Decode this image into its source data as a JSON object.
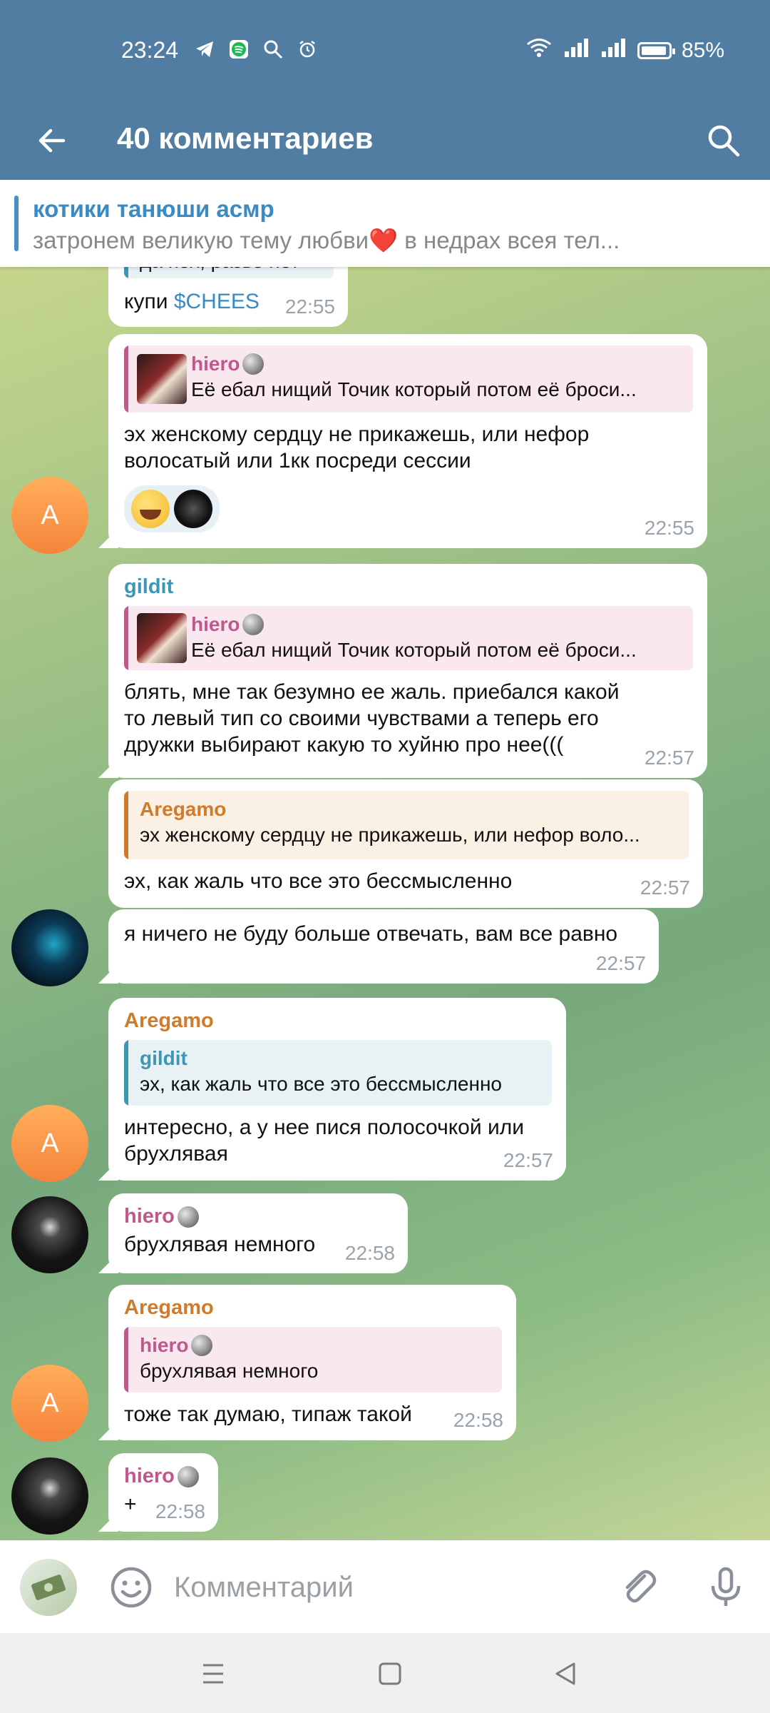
{
  "status_bar": {
    "time": "23:24",
    "battery": "85%",
    "battery_level": 0.85
  },
  "header": {
    "title": "40 комментариев"
  },
  "pinned": {
    "title": "котики танюши асмр",
    "text": "затронем великую тему любви❤️  в недрах всея тел..."
  },
  "messages": [
    {
      "partial_quote": "да пох, разве нет",
      "text_prefix": "купи ",
      "text_link": "$CHEES",
      "time": "22:55"
    },
    {
      "reply_name": "hiero",
      "reply_text": "Её ебал нищий Точик который потом её броси...",
      "text": "эх женскому сердцу не прикажешь, или нефор волосатый или 1кк посреди сессии",
      "avatar_letter": "A",
      "time": "22:55"
    },
    {
      "sender": "gildit",
      "reply_name": "hiero",
      "reply_text": "Её ебал нищий Точик который потом её броси...",
      "text": "блять, мне так безумно ее жаль. приебался какой то левый тип со своими чувствами а теперь его дружки выбирают какую то хуйню про нее(((",
      "time": "22:57"
    },
    {
      "reply_name": "Aregamo",
      "reply_text": "эх женскому сердцу не прикажешь, или нефор воло...",
      "text": "эх, как жаль что все это бессмысленно",
      "time": "22:57"
    },
    {
      "text": "я ничего не буду больше отвечать, вам все равно",
      "time": "22:57"
    },
    {
      "sender": "Aregamo",
      "reply_name": "gildit",
      "reply_text": "эх, как жаль что все это бессмысленно",
      "text": "интересно, а у нее пися полосочкой или брухлявая",
      "avatar_letter": "A",
      "time": "22:57"
    },
    {
      "sender": "hiero",
      "text": "брухлявая немного",
      "time": "22:58"
    },
    {
      "sender": "Aregamo",
      "reply_name": "hiero",
      "reply_text": "брухлявая немного",
      "text": "тоже так думаю, типаж такой",
      "avatar_letter": "A",
      "time": "22:58"
    },
    {
      "sender": "hiero",
      "text": "+",
      "time": "22:58"
    }
  ],
  "input": {
    "placeholder": "Комментарий"
  },
  "colors": {
    "header": "#527da3",
    "pink": "#c1588c",
    "teal": "#3d97b3",
    "orange": "#d07b2c"
  }
}
